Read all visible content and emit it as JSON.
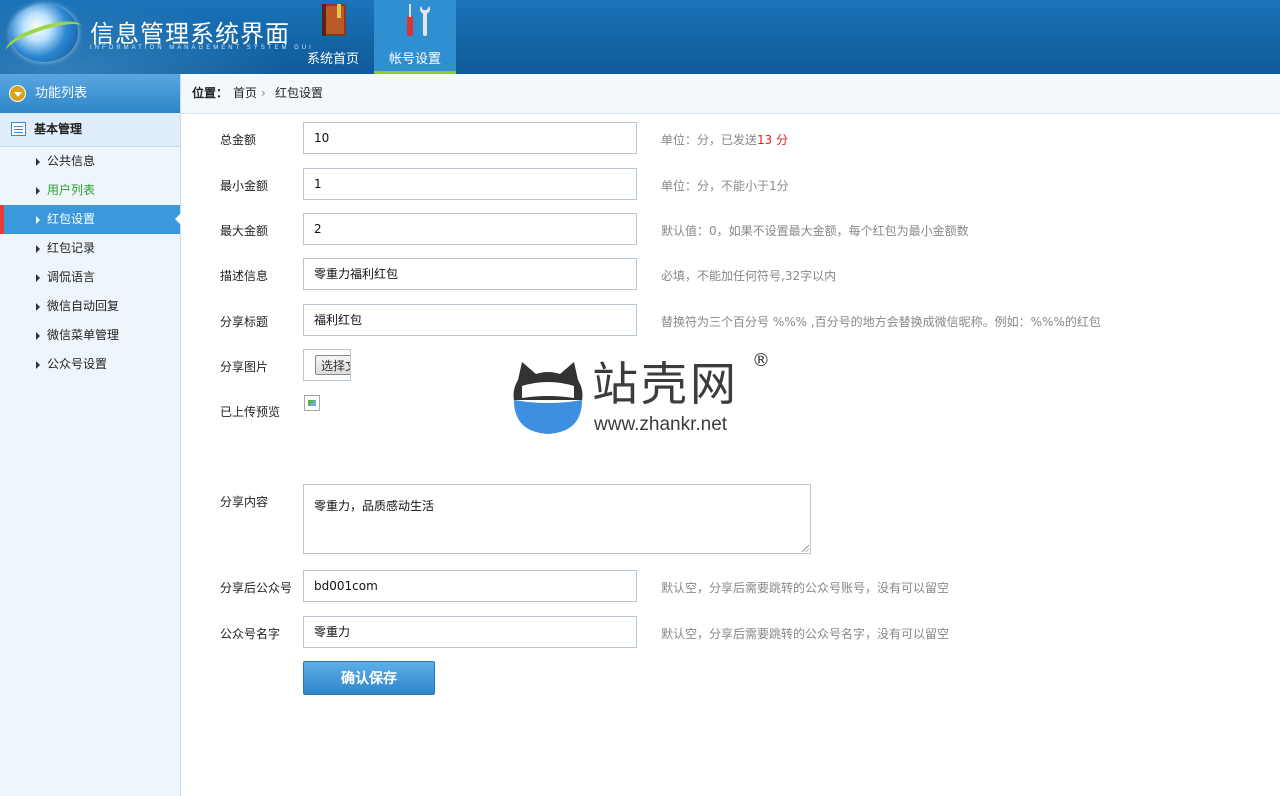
{
  "header": {
    "title": "信息管理系统界面",
    "subtitle": "INFORMATION MANAGEMENT SYSTEM GUI",
    "nav": [
      {
        "label": "系统首页",
        "icon": "book-icon"
      },
      {
        "label": "帐号设置",
        "icon": "tools-icon",
        "active": true
      }
    ]
  },
  "sidebar": {
    "header": "功能列表",
    "group": "基本管理",
    "items": [
      {
        "label": "公共信息"
      },
      {
        "label": "用户列表",
        "color": "#2f9c2f"
      },
      {
        "label": "红包设置",
        "active": true
      },
      {
        "label": "红包记录"
      },
      {
        "label": "调侃语言"
      },
      {
        "label": "微信自动回复"
      },
      {
        "label": "微信菜单管理"
      },
      {
        "label": "公众号设置"
      }
    ]
  },
  "breadcrumb": {
    "position_label": "位置：",
    "home": "首页",
    "current": "红包设置"
  },
  "form": {
    "total_amount": {
      "label": "总金额",
      "value": "10",
      "hint_prefix": "单位：分，已发送",
      "hint_highlight": "13 分"
    },
    "min_amount": {
      "label": "最小金额",
      "value": "1",
      "hint": "单位：分，不能小于1分"
    },
    "max_amount": {
      "label": "最大金额",
      "value": "2",
      "hint": "默认值：0，如果不设置最大金额，每个红包为最小金额数"
    },
    "description": {
      "label": "描述信息",
      "value": "零重力福利红包",
      "hint": "必填，不能加任何符号,32字以内"
    },
    "share_title": {
      "label": "分享标题",
      "value": "福利红包",
      "hint": "替换符为三个百分号 %%% ,百分号的地方会替换成微信昵称。例如：%%%的红包"
    },
    "share_image": {
      "label": "分享图片",
      "button": "选择文件"
    },
    "preview": {
      "label": "已上传预览"
    },
    "share_content": {
      "label": "分享内容",
      "value": "零重力，品质感动生活"
    },
    "after_share_account": {
      "label": "分享后公众号",
      "value": "bd001com",
      "hint": "默认空，分享后需要跳转的公众号账号，没有可以留空"
    },
    "account_name": {
      "label": "公众号名字",
      "value": "零重力",
      "hint": "默认空，分享后需要跳转的公众号名字，没有可以留空"
    },
    "save_label": "确认保存"
  },
  "watermark": {
    "name": "站壳网",
    "registered": "®",
    "url": "www.zhankr.net"
  },
  "colors": {
    "header": "#1466a8",
    "accent": "#3a98db",
    "active_marker": "#e53b3b",
    "nav_underline": "#8ccf2d",
    "link_green": "#2f9c2f",
    "hint_red": "#e02020"
  }
}
